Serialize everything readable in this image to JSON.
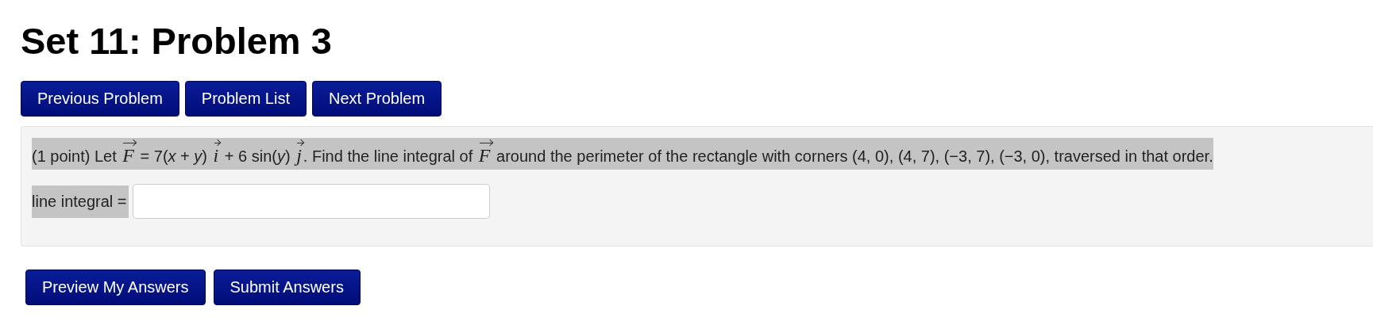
{
  "title": "Set 11: Problem 3",
  "nav_buttons": [
    "Previous Problem",
    "Problem List",
    "Next Problem"
  ],
  "problem": {
    "statement": "(1 point) Let **F** = 7(*x* + *y*) **i** + 6 sin(*y*) **j**. Find the line integral of **F** around the perimeter of the rectangle with corners (4, 0), (4, 7), (−3, 7), (−3, 0), traversed in that order.",
    "answer_label": "line integral ="
  },
  "submit_buttons": [
    "Preview My Answers",
    "Submit Answers"
  ]
}
